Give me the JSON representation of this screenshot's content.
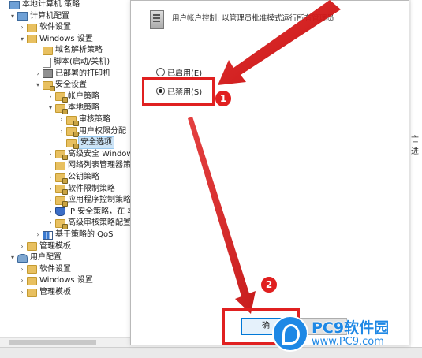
{
  "tree": {
    "items": [
      {
        "label": "本地计算机 策略",
        "expander": "",
        "icon": "pc"
      },
      {
        "label": "计算机配置",
        "expander": "▾",
        "icon": "pc"
      },
      {
        "label": "软件设置",
        "expander": "›",
        "icon": "folder"
      },
      {
        "label": "Windows 设置",
        "expander": "▾",
        "icon": "folder"
      },
      {
        "label": "域名解析策略",
        "expander": "",
        "icon": "folder"
      },
      {
        "label": "脚本(启动/关机)",
        "expander": "",
        "icon": "doc"
      },
      {
        "label": "已部署的打印机",
        "expander": "›",
        "icon": "printer"
      },
      {
        "label": "安全设置",
        "expander": "▾",
        "icon": "folder-lock"
      },
      {
        "label": "帐户策略",
        "expander": "›",
        "icon": "folder-lock"
      },
      {
        "label": "本地策略",
        "expander": "▾",
        "icon": "folder-lock"
      },
      {
        "label": "审核策略",
        "expander": "›",
        "icon": "folder-lock"
      },
      {
        "label": "用户权限分配",
        "expander": "›",
        "icon": "folder-lock"
      },
      {
        "label": "安全选项",
        "expander": "",
        "icon": "folder-lock"
      },
      {
        "label": "高级安全 Windows",
        "expander": "›",
        "icon": "folder-lock"
      },
      {
        "label": "网络列表管理器策略",
        "expander": "",
        "icon": "folder"
      },
      {
        "label": "公钥策略",
        "expander": "›",
        "icon": "folder-lock"
      },
      {
        "label": "软件限制策略",
        "expander": "›",
        "icon": "folder-lock"
      },
      {
        "label": "应用程序控制策略",
        "expander": "›",
        "icon": "folder-lock"
      },
      {
        "label": "IP 安全策略，在 本",
        "expander": "›",
        "icon": "shield"
      },
      {
        "label": "高级审核策略配置",
        "expander": "›",
        "icon": "folder-lock"
      },
      {
        "label": "基于策略的 QoS",
        "expander": "›",
        "icon": "chart"
      },
      {
        "label": "管理模板",
        "expander": "›",
        "icon": "folder"
      },
      {
        "label": "用户配置",
        "expander": "▾",
        "icon": "user"
      },
      {
        "label": "软件设置",
        "expander": "›",
        "icon": "folder"
      },
      {
        "label": "Windows 设置",
        "expander": "›",
        "icon": "folder"
      },
      {
        "label": "管理模板",
        "expander": "›",
        "icon": "folder"
      }
    ],
    "selected_label": "安全选项"
  },
  "dialog": {
    "title": "用户帐户控制: 以管理员批准模式运行所有管理员",
    "options": [
      {
        "label": "已启用(E)",
        "checked": false
      },
      {
        "label": "已禁用(S)",
        "checked": true
      }
    ],
    "ok_label": "确"
  },
  "side_fragment": "亡进",
  "annotations": {
    "step1": "1",
    "step2": "2",
    "color": "#e02020"
  },
  "watermark": {
    "name": "PC9软件园",
    "url": "www.PC9.com"
  }
}
